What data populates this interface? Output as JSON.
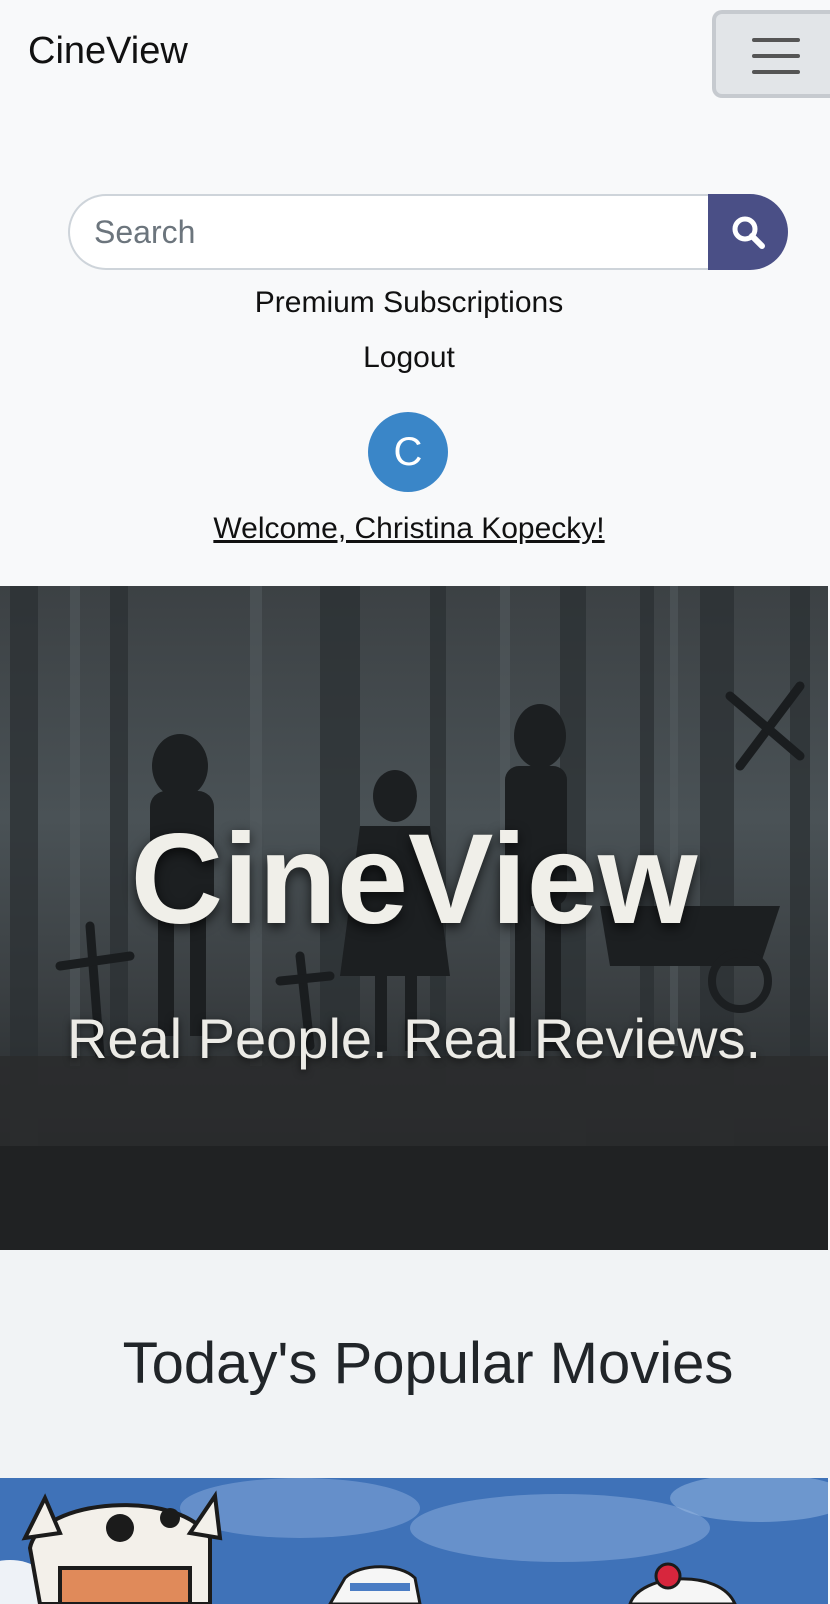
{
  "navbar": {
    "brand": "CineView",
    "search_placeholder": "Search",
    "links": [
      "Premium Subscriptions",
      "Logout"
    ],
    "avatar_initial": "C",
    "welcome": "Welcome, Christina Kopecky!"
  },
  "hero": {
    "title": "CineView",
    "tagline": "Real People. Real Reviews."
  },
  "popular": {
    "title": "Today's Popular Movies"
  },
  "colors": {
    "search_button": "#4a4f86",
    "avatar": "#3a86c8",
    "background": "#f8f9fa"
  },
  "icons": [
    "hamburger-menu-icon",
    "search-icon"
  ]
}
